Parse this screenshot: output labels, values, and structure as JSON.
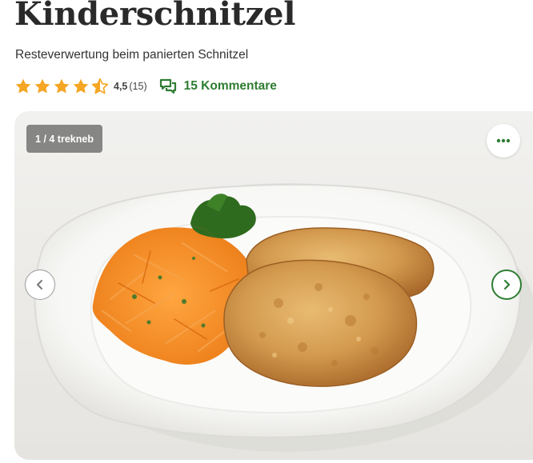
{
  "recipe": {
    "title": "Kinderschnitzel",
    "subtitle": "Resteverwertung beim panierten Schnitzel"
  },
  "rating": {
    "value": "4,5",
    "count": "(15)",
    "stars_out_of_5": 4.5,
    "star_color": "#f5a623"
  },
  "comments": {
    "label": "15 Kommentare",
    "icon": "chat-bubbles-icon",
    "color": "#2e7d32"
  },
  "gallery": {
    "counter": "1 / 4 trekneb",
    "current_image": 1,
    "total_images": 4,
    "more_icon": "more-horizontal-icon",
    "prev_icon": "chevron-left-icon",
    "next_icon": "chevron-right-icon",
    "accent": "#2e7d32"
  }
}
